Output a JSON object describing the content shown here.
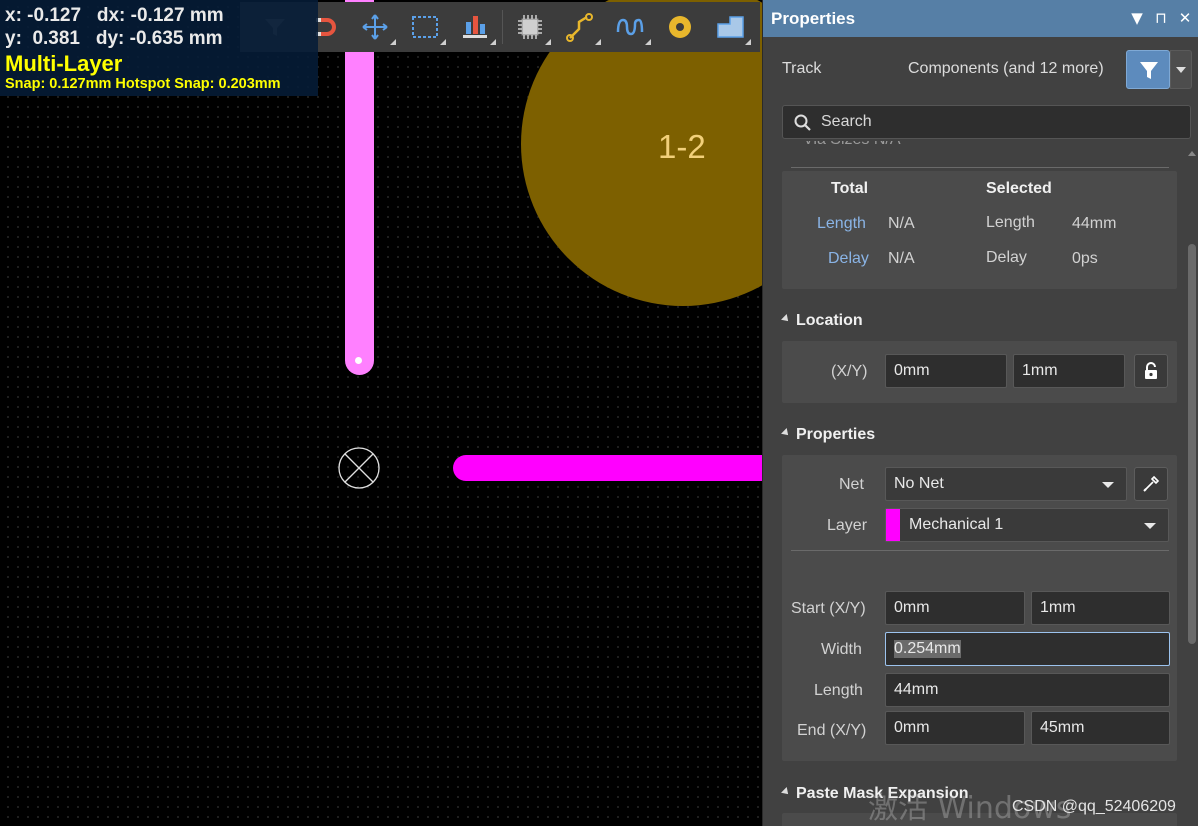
{
  "hud": {
    "x_line": "x: -0.127   dx: -0.127 mm",
    "y_line": "y:  0.381   dy: -0.635 mm",
    "layer": "Multi-Layer",
    "snap": "Snap: 0.127mm Hotspot Snap: 0.203mm",
    "colors": {
      "background": "#061c38",
      "text": "#eaeaea",
      "highlight": "#ffff00"
    }
  },
  "toolbar": {
    "icons": [
      "filter-icon",
      "magnet-icon",
      "move-icon",
      "select-rect-icon",
      "align-icon",
      "component-icon",
      "route-icon",
      "length-tune-icon",
      "via-icon",
      "polygon-icon"
    ]
  },
  "canvas": {
    "pad_label": "1-2",
    "colors": {
      "pad": "#7d6000",
      "pad_label": "#f2d07a",
      "track_vertical": "#ff80ff",
      "track_horizontal": "#ff00ff"
    }
  },
  "panel": {
    "title": "Properties",
    "title_controls": [
      "▼",
      "⊓",
      "✕"
    ],
    "object_kind": "Track",
    "object_filter": "Components (and 12 more)",
    "search_placeholder": "Search",
    "clipped_row": "Via Sizes  N/A",
    "accent_color": "#567fa6",
    "totals": {
      "total_heading": "Total",
      "selected_heading": "Selected",
      "length_label": "Length",
      "delay_label": "Delay",
      "total_length": "N/A",
      "total_delay": "N/A",
      "selected_length": "44mm",
      "selected_delay": "0ps"
    },
    "location": {
      "heading": "Location",
      "xy_label": "(X/Y)",
      "x": "0mm",
      "y": "1mm",
      "lock_icon": "lock-icon"
    },
    "properties": {
      "heading": "Properties",
      "net_label": "Net",
      "net_value": "No Net",
      "layer_label": "Layer",
      "layer_value": "Mechanical 1",
      "layer_color": "#ff00ff",
      "start_label": "Start (X/Y)",
      "start_x": "0mm",
      "start_y": "1mm",
      "width_label": "Width",
      "width_value": "0.254mm",
      "length_label": "Length",
      "length_value": "44mm",
      "end_label": "End (X/Y)",
      "end_x": "0mm",
      "end_y": "45mm"
    },
    "paste_mask": {
      "heading": "Paste Mask Expansion"
    }
  },
  "watermark": {
    "activate_windows": "激活 Windows",
    "csdn": "CSDN @qq_52406209"
  }
}
